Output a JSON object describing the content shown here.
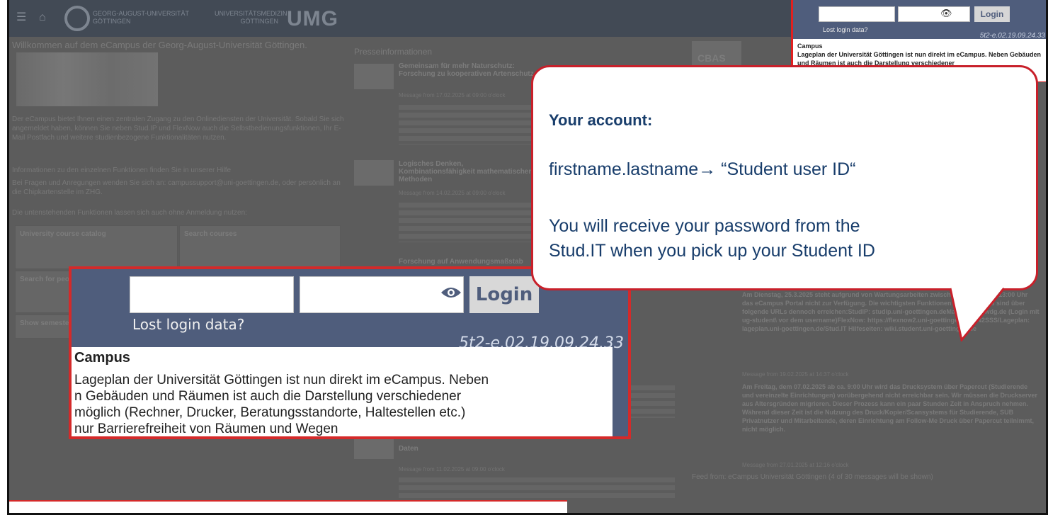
{
  "nav": {
    "logo_text1": "GEORG-AUGUST-UNIVERSITÄT GÖTTINGEN",
    "logo_text2": "UNIVERSITÄTSMEDIZIN GÖTTINGEN",
    "logo_umg": "UMG"
  },
  "left": {
    "welcome": "Willkommen auf dem eCampus der Georg-August-Universität Göttingen.",
    "intro": "Der eCampus bietet Ihnen einen zentralen Zugang zu den Onlinediensten der Universität. Sobald Sie sich angemeldet haben, können Sie neben Stud.IP und FlexNow auch die Selbstbedienungsfunktionen, Ihr E-Mail Postfach und weitere studienbezogene Funktionalitäten nutzen.",
    "help": "Informationen zu den einzelnen Funktionen finden Sie in unserer Hilfe",
    "contact": "Bei Fragen und Anregungen wenden Sie sich an: campussupport@uni-goettingen.de, oder persönlich an die Chipkartenstelle im ZHG.",
    "functions": "Die untenstehenden Funktionen lassen sich auch ohne Anmeldung nutzen:",
    "cells": [
      "University course catalog",
      "Search courses",
      "Search for people",
      "Show semester"
    ]
  },
  "press": {
    "heading": "Presseinformationen",
    "items": [
      {
        "title": "Gemeinsam für mehr Naturschutz: Forschung zu kooperativen Artenschutz",
        "meta": "Message from 17.02.2025 at 09:00 o'clock"
      },
      {
        "title": "Logisches Denken, Kombinationsfähigkeit mathematischen Methoden",
        "meta": "Message from 14.02.2025 at 09:00 o'clock"
      },
      {
        "title": "Forschung auf Anwendungsmaßstab",
        "meta": ""
      },
      {
        "title": "Daten",
        "meta": "Message from 11.02.2025 at 09:00 o'clock"
      }
    ]
  },
  "right": {
    "cbas": "CBAS",
    "news1": "Am Dienstag, 25.3.2025 steht aufgrund von Wartungsarbeiten zwischen ca. 9:00 und 13:00 Uhr das eCampus Portal nicht zur Verfügung. Die wichtigsten Funktionen des eCampus sind über folgende URLs dennoch erreichen:StudIP: studip.uni-goettingen.deMail: email.gwdg.de (Login mit ug-student\\ vor dem username)FlexNow: https://flexnow2.uni-goettingen.de/FN2SSS/Lageplan: lageplan.uni-goettingen.de/Stud.IT Hilfeseiten: wiki.student.uni-goettingen.de",
    "meta1": "Message from 19.02.2025 at 14:37 o'clock",
    "news2": "Am Freitag, dem 07.02.2025 ab ca. 9:00 Uhr wird das Drucksystem über Papercut (Studierende und vereinzelte Einrichtungen) vorübergehend nicht erreichbar sein. Wir müssen die Druckserver aus Altersgründen migrieren. Dieser Prozess kann ein paar Stunden Zeit in Anspruch nehmen. Während dieser Zeit ist die Nutzung des Druck/Kopier/Scansystems für Studierende, SUB Privatnutzer und Mitarbeitende, deren Einrichtung am Follow-Me Druck über Papercut teilnimmt, nicht möglich.",
    "meta2": "Message from 27.01.2025 at 12:16 o'clock",
    "feed": "Feed from: eCampus Universität Göttingen (4 of 30 messages will be shown)"
  },
  "login": {
    "button": "Login",
    "lost": "Lost login data?",
    "version": "5t2-e.02.19.09.24.33",
    "campus_title": "Campus",
    "campus_lines": [
      "Lageplan der Universität Göttingen ist nun direkt im eCampus. Neben",
      "n Gebäuden und Räumen ist auch die Darstellung verschiedener",
      "möglich (Rechner, Drucker, Beratungsstandorte, Haltestellen etc.)",
      "nur Barrierefreiheit von Räumen und Wegen"
    ],
    "small_campus": "Campus",
    "small_text": "Lageplan der Universität Göttingen ist nun direkt im eCampus. Neben Gebäuden und Räumen ist auch die Darstellung verschiedener"
  },
  "callout": {
    "heading": "Your account:",
    "line1": "firstname.lastname→ “Student user ID“",
    "line2": "You will receive your password from the",
    "line3": "Stud.IT when you pick up your Student ID"
  },
  "colors": {
    "accent": "#c8202a",
    "login_bg": "#4f5d7c",
    "callout_text": "#183d6b"
  }
}
